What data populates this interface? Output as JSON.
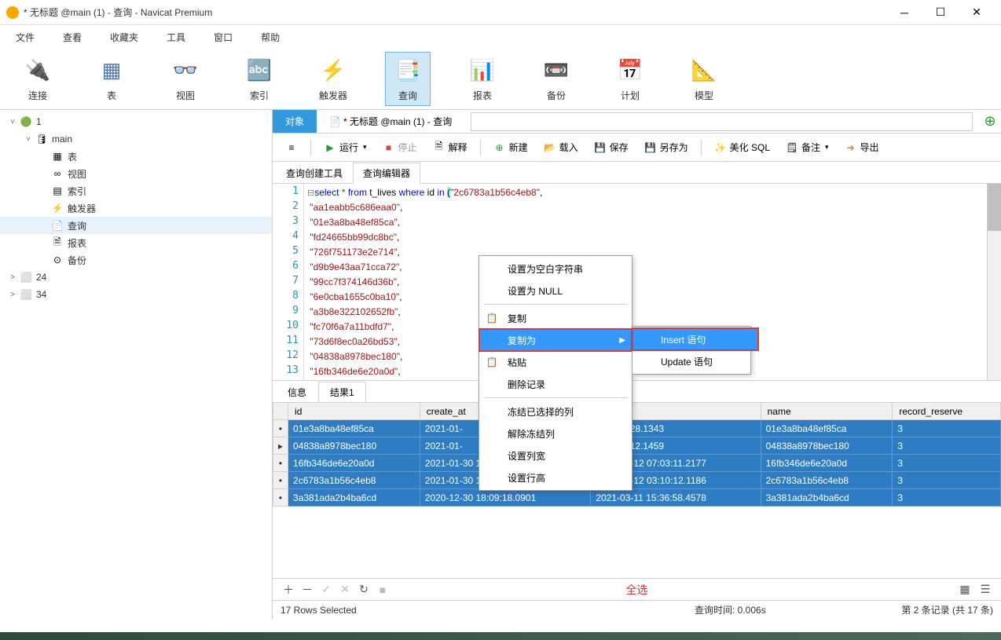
{
  "window": {
    "title": "* 无标题 @main (1) - 查询 - Navicat Premium"
  },
  "menubar": [
    "文件",
    "查看",
    "收藏夹",
    "工具",
    "窗口",
    "帮助"
  ],
  "toolbar": [
    {
      "label": "连接",
      "icon": "plug"
    },
    {
      "label": "表",
      "icon": "table"
    },
    {
      "label": "视图",
      "icon": "view"
    },
    {
      "label": "索引",
      "icon": "index"
    },
    {
      "label": "触发器",
      "icon": "trigger"
    },
    {
      "label": "查询",
      "icon": "query",
      "active": true
    },
    {
      "label": "报表",
      "icon": "report"
    },
    {
      "label": "备份",
      "icon": "backup"
    },
    {
      "label": "计划",
      "icon": "schedule"
    },
    {
      "label": "模型",
      "icon": "model"
    }
  ],
  "tree": [
    {
      "label": "1",
      "depth": 0,
      "expanded": true,
      "icon": "db-green"
    },
    {
      "label": "main",
      "depth": 1,
      "expanded": true,
      "icon": "db-cyl"
    },
    {
      "label": "表",
      "depth": 2,
      "icon": "tbl"
    },
    {
      "label": "视图",
      "depth": 2,
      "icon": "view"
    },
    {
      "label": "索引",
      "depth": 2,
      "icon": "idx"
    },
    {
      "label": "触发器",
      "depth": 2,
      "icon": "trg"
    },
    {
      "label": "查询",
      "depth": 2,
      "icon": "qry",
      "selected": true
    },
    {
      "label": "报表",
      "depth": 2,
      "icon": "rpt"
    },
    {
      "label": "备份",
      "depth": 2,
      "icon": "bkp"
    },
    {
      "label": "24",
      "depth": 0,
      "icon": "db-gray"
    },
    {
      "label": "34",
      "depth": 0,
      "icon": "db-gray"
    }
  ],
  "tabs": {
    "items": [
      {
        "label": "对象",
        "active": true
      },
      {
        "label": "* 无标题 @main (1) - 查询"
      }
    ],
    "search_placeholder": ""
  },
  "actions": {
    "run": "运行",
    "stop": "停止",
    "explain": "解释",
    "new": "新建",
    "load": "载入",
    "save": "保存",
    "saveas": "另存为",
    "beautify": "美化 SQL",
    "note": "备注",
    "export": "导出"
  },
  "subtabs": [
    "查询创建工具",
    "查询编辑器"
  ],
  "code": {
    "keyword_select": "select",
    "keyword_from": "from",
    "keyword_where": "where",
    "keyword_in": "in",
    "star": "*",
    "table": "t_lives",
    "col": "id",
    "ids": [
      "2c6783a1b56c4eb8",
      "aa1eabb5c686eaa0",
      "01e3a8ba48ef85ca",
      "fd24665bb99dc8bc",
      "726f751173e2e714",
      "d9b9e43aa71cca72",
      "99cc7f374146d36b",
      "6e0cba1655c0ba10",
      "a3b8e322102652fb",
      "fc70f6a7a11bdfd7",
      "73d6f8ec0a26bd53",
      "04838a8978bec180",
      "16fb346de6e20a0d"
    ]
  },
  "info_tabs": [
    "信息",
    "结果1"
  ],
  "grid": {
    "columns": [
      "id",
      "create_at",
      "",
      "name",
      "record_reserve"
    ],
    "rows": [
      {
        "ind": "•",
        "id": "01e3a8ba48ef85ca",
        "create_at": "2021-01-",
        "c3": "2 10:19:28.1343",
        "name": "01e3a8ba48ef85ca",
        "record_reserve": "3"
      },
      {
        "ind": "▸",
        "id": "04838a8978bec180",
        "create_at": "2021-01-",
        "c3": "2 03:05:12.1459",
        "name": "04838a8978bec180",
        "record_reserve": "3"
      },
      {
        "ind": "•",
        "id": "16fb346de6e20a0d",
        "create_at": "2021-01-30 11:55:18.4980",
        "c3": "2021-03-12 07:03:11.2177",
        "name": "16fb346de6e20a0d",
        "record_reserve": "3"
      },
      {
        "ind": "•",
        "id": "2c6783a1b56c4eb8",
        "create_at": "2021-01-30 19:47:17.1361",
        "c3": "2021-03-12 03:10:12.1186",
        "name": "2c6783a1b56c4eb8",
        "record_reserve": "3"
      },
      {
        "ind": "•",
        "id": "3a381ada2b4ba6cd",
        "create_at": "2020-12-30 18:09:18.0901",
        "c3": "2021-03-11 15:36:58.4578",
        "name": "3a381ada2b4ba6cd",
        "record_reserve": "3"
      }
    ]
  },
  "grid_footer": {
    "center": "全选"
  },
  "statusbar": {
    "left": "17 Rows Selected",
    "mid": "查询时间: 0.006s",
    "right": "第 2 条记录 (共 17 条)"
  },
  "ctx_main": [
    {
      "label": "设置为空白字符串"
    },
    {
      "label": "设置为 NULL"
    },
    {
      "sep": true
    },
    {
      "label": "复制",
      "icon": "copy"
    },
    {
      "label": "复制为",
      "highlight": true,
      "arrow": true,
      "red": true
    },
    {
      "label": "粘贴",
      "icon": "paste"
    },
    {
      "label": "删除记录"
    },
    {
      "sep": true
    },
    {
      "label": "冻结已选择的列"
    },
    {
      "label": "解除冻结列"
    },
    {
      "label": "设置列宽"
    },
    {
      "label": "设置行高"
    }
  ],
  "ctx_sub": [
    {
      "label": "Insert 语句",
      "highlight": true,
      "red": true
    },
    {
      "label": "Update 语句"
    }
  ]
}
